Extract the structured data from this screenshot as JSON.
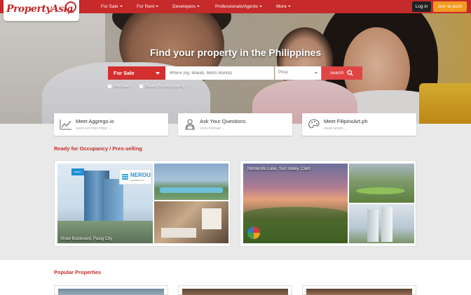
{
  "brand": {
    "name": "PropertyAsia",
    "suffix": ".ph",
    "primary_color": "#c62a2a",
    "accent_color": "#f39a21"
  },
  "nav": {
    "items": [
      {
        "label": "For Sale"
      },
      {
        "label": "For Rent"
      },
      {
        "label": "Developers"
      },
      {
        "label": "Professionals/Agents"
      },
      {
        "label": "More"
      }
    ],
    "login_label": "Log in",
    "post_label": "Join to post!"
  },
  "hero": {
    "title": "Find your property in the Philippines",
    "search": {
      "type_value": "For Sale",
      "where_placeholder": "Where (eg. Makati, Metro Manila)",
      "price_value": "Price",
      "button_label": "search",
      "button_icon": "search-icon"
    },
    "checks": [
      {
        "label": "Pre-sale",
        "checked": false
      },
      {
        "label": "Ready for occupancy",
        "checked": false
      }
    ]
  },
  "cards": [
    {
      "title": "Meet Aggrego.io",
      "subtitle": "SIGN UP FOR FREE →",
      "icon": "chart-icon"
    },
    {
      "title": "Ask Your Questions",
      "subtitle": "JOIN FORUM →",
      "icon": "people-icon"
    },
    {
      "title": "Meet FilipinoArt.ph",
      "subtitle": "VIEW MORE →",
      "icon": "art-icon"
    }
  ],
  "ready_section": {
    "title": "Ready for Occupancy / Pres-selling",
    "listings": [
      {
        "caption": "Shaw Boulevard, Pasig City",
        "logo_text": "NEROU",
        "logo_sub": "RESIDENCES"
      },
      {
        "caption": "Montecillo Lake, Sun Valley, Clark"
      }
    ]
  },
  "popular_section": {
    "title": "Popular Properties"
  }
}
